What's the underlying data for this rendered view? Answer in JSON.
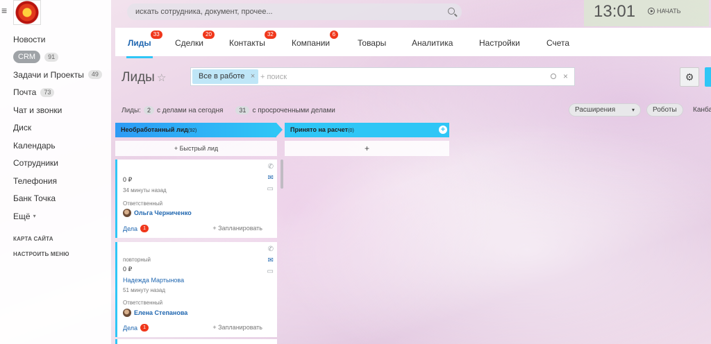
{
  "sidebar": {
    "menu": [
      {
        "label": "Новости",
        "count": ""
      },
      {
        "label": "CRM",
        "count": "91"
      },
      {
        "label": "Задачи и Проекты",
        "count": "49"
      },
      {
        "label": "Почта",
        "count": "73"
      },
      {
        "label": "Чат и звонки",
        "count": ""
      },
      {
        "label": "Диск",
        "count": ""
      },
      {
        "label": "Календарь",
        "count": ""
      },
      {
        "label": "Сотрудники",
        "count": ""
      },
      {
        "label": "Телефония",
        "count": ""
      },
      {
        "label": "Банк Точка",
        "count": ""
      },
      {
        "label": "Ещё",
        "count": ""
      }
    ],
    "more_arrow": "▾",
    "sitemap": "КАРТА САЙТА",
    "configure": "НАСТРОИТЬ МЕНЮ"
  },
  "header": {
    "search_placeholder": "искать сотрудника, документ, прочее...",
    "time": "13:01",
    "start": "НАЧАТЬ"
  },
  "tabs": [
    {
      "label": "Лиды",
      "badge": "33"
    },
    {
      "label": "Сделки",
      "badge": "20"
    },
    {
      "label": "Контакты",
      "badge": "32"
    },
    {
      "label": "Компании",
      "badge": "6"
    },
    {
      "label": "Товары",
      "badge": ""
    },
    {
      "label": "Аналитика",
      "badge": ""
    },
    {
      "label": "Настройки",
      "badge": ""
    },
    {
      "label": "Счета",
      "badge": ""
    }
  ],
  "page": {
    "title": "Лиды",
    "filter_chip": "Все в работе",
    "filter_placeholder": "+ поиск"
  },
  "stats": {
    "leads_label": "Лиды:",
    "today_count": "2",
    "today_text": "с делами на сегодня",
    "overdue_count": "31",
    "overdue_text": "с просроченными делами",
    "extensions": "Расширения",
    "robots": "Роботы",
    "kanban": "Канба"
  },
  "columns": [
    {
      "title": "Необработанный лид",
      "count": "(92)",
      "quick": "+ Быстрый лид"
    },
    {
      "title": "Принято на расчет",
      "count": "(0)",
      "quick": "+"
    }
  ],
  "cards": [
    {
      "tag": "",
      "amount": "0 ₽",
      "name": "",
      "time": "34 минуты назад",
      "resp_label": "Ответственный",
      "resp_name": "Ольга Черниченко",
      "deals": "Дела",
      "deals_count": "1",
      "plan": "+ Запланировать"
    },
    {
      "tag": "повторный",
      "amount": "0 ₽",
      "name": "Надежда Мартынова",
      "time": "51 минуту назад",
      "resp_label": "Ответственный",
      "resp_name": "Елена Степанова",
      "deals": "Дела",
      "deals_count": "1",
      "plan": "+ Запланировать"
    }
  ]
}
